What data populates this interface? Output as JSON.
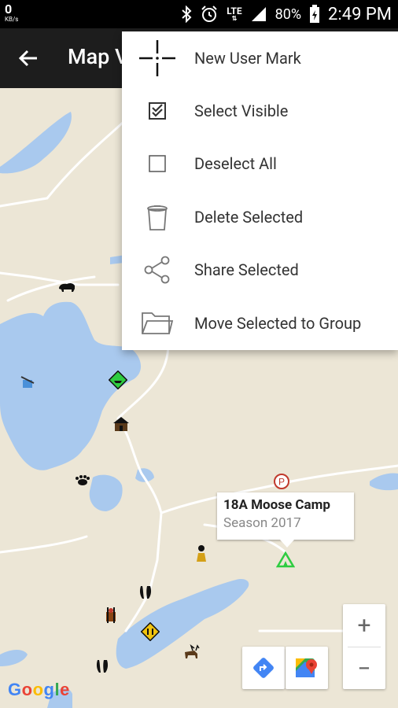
{
  "status_bar": {
    "data_rate": "0",
    "data_unit": "KB/s",
    "network": "LTE",
    "battery": "80%",
    "time": "2:49 PM"
  },
  "app_bar": {
    "title": "Map V"
  },
  "menu": {
    "items": [
      {
        "label": "New User Mark",
        "icon": "crosshair-icon"
      },
      {
        "label": "Select Visible",
        "icon": "checked-checkbox-icon"
      },
      {
        "label": "Deselect All",
        "icon": "empty-checkbox-icon"
      },
      {
        "label": "Delete Selected",
        "icon": "trash-icon"
      },
      {
        "label": "Share Selected",
        "icon": "share-icon"
      },
      {
        "label": "Move Selected to Group",
        "icon": "folder-icon"
      }
    ]
  },
  "info_window": {
    "title": "18A Moose Camp",
    "subtitle": "Season 2017"
  },
  "zoom": {
    "in_label": "+",
    "out_label": "−"
  },
  "attribution": {
    "logo_text": "Google"
  },
  "colors": {
    "water": "#a9c9ee",
    "land": "#ece6d6",
    "road": "#ffffff",
    "appbar": "#1d1d1d"
  }
}
